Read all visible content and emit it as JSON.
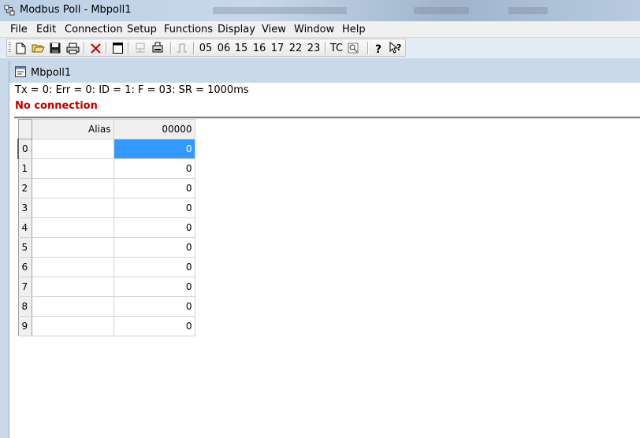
{
  "window": {
    "title": "Modbus Poll - Mbpoll1"
  },
  "menu": {
    "items": [
      "File",
      "Edit",
      "Connection",
      "Setup",
      "Functions",
      "Display",
      "View",
      "Window",
      "Help"
    ]
  },
  "toolbar": {
    "icons": [
      "new-document-icon",
      "open-folder-icon",
      "save-icon",
      "print-icon",
      "disconnect-icon",
      "window-icon",
      "connect-icon",
      "read-device-icon",
      "pulse-icon",
      "test-center-icon",
      "help-icon",
      "context-help-icon"
    ],
    "function_codes": [
      "05",
      "06",
      "15",
      "16",
      "17",
      "22",
      "23"
    ],
    "tc_label": "TC"
  },
  "child_window": {
    "title": "Mbpoll1",
    "status_line": "Tx = 0: Err = 0: ID = 1: F = 03: SR = 1000ms",
    "error_line": "No connection",
    "error_color": "#c00000"
  },
  "grid": {
    "headers": [
      "Alias",
      "00000"
    ],
    "rows": [
      {
        "index": "0",
        "alias": "",
        "value": "0"
      },
      {
        "index": "1",
        "alias": "",
        "value": "0"
      },
      {
        "index": "2",
        "alias": "",
        "value": "0"
      },
      {
        "index": "3",
        "alias": "",
        "value": "0"
      },
      {
        "index": "4",
        "alias": "",
        "value": "0"
      },
      {
        "index": "5",
        "alias": "",
        "value": "0"
      },
      {
        "index": "6",
        "alias": "",
        "value": "0"
      },
      {
        "index": "7",
        "alias": "",
        "value": "0"
      },
      {
        "index": "8",
        "alias": "",
        "value": "0"
      },
      {
        "index": "9",
        "alias": "",
        "value": "0"
      }
    ],
    "selected_row": 0,
    "selection_color": "#3399ff"
  }
}
